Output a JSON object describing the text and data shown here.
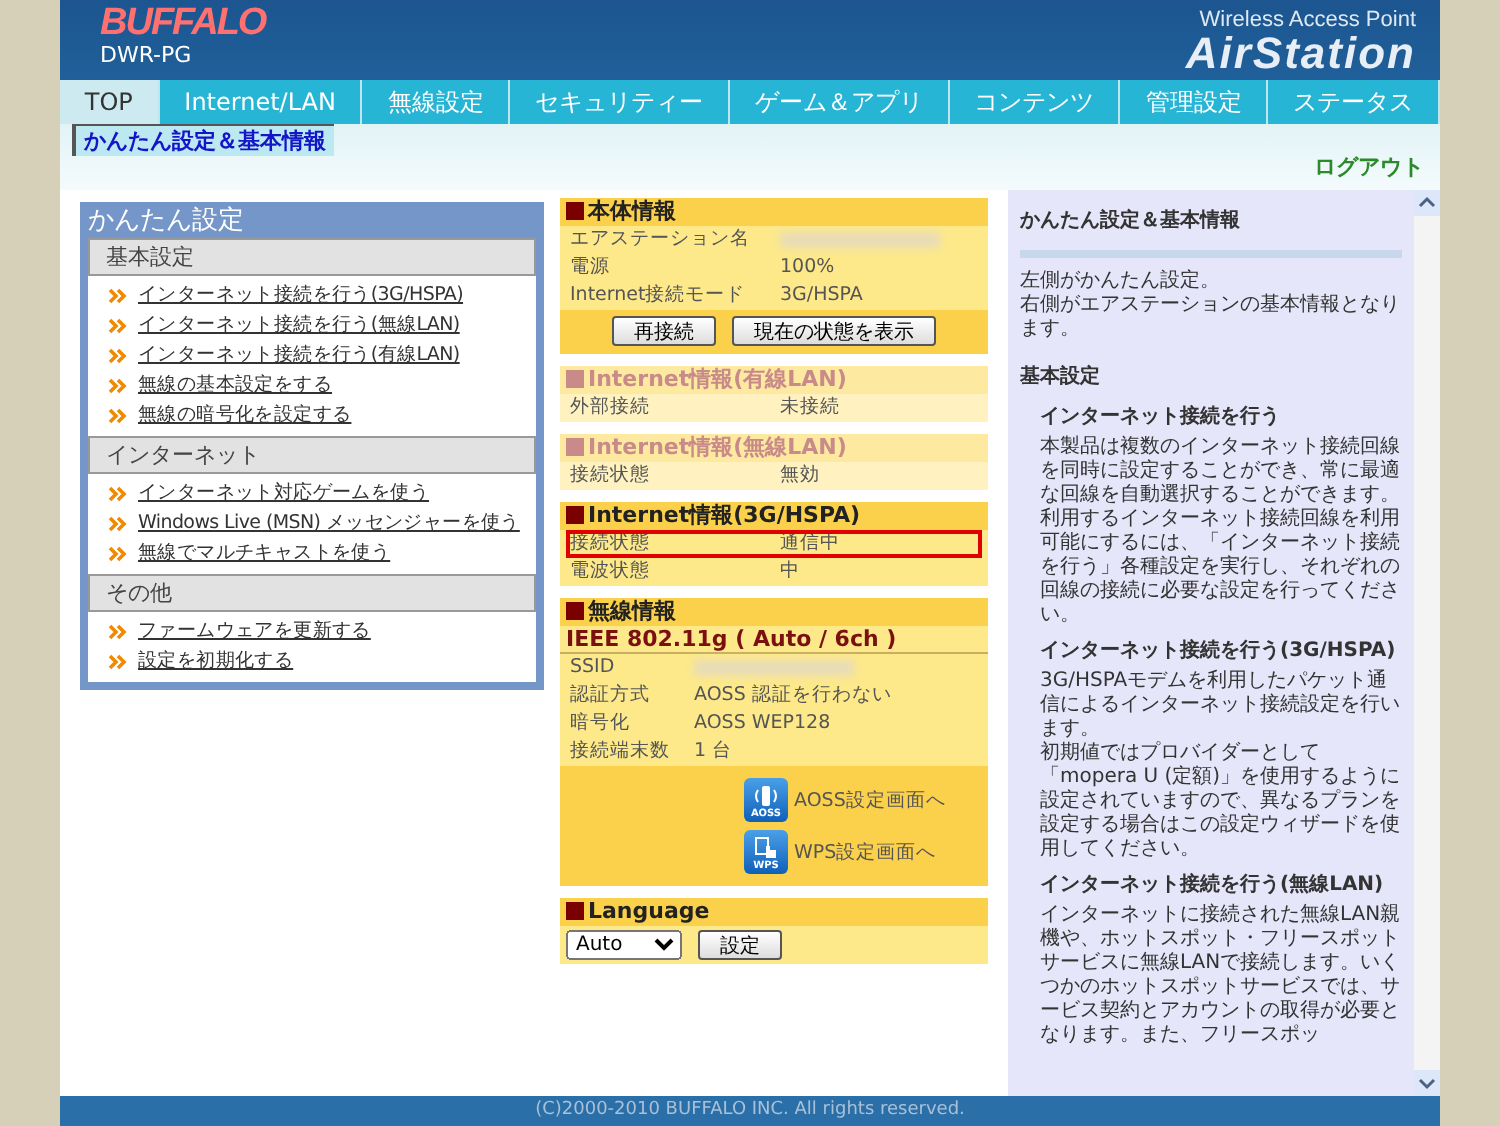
{
  "header": {
    "logo": "BUFFALO",
    "model": "DWR-PG",
    "product_line": "Wireless Access Point",
    "product_name": "AirStation"
  },
  "nav_tabs": [
    {
      "label": "TOP",
      "selected": true
    },
    {
      "label": "Internet/LAN",
      "selected": false
    },
    {
      "label": "無線設定",
      "selected": false
    },
    {
      "label": "セキュリティー",
      "selected": false
    },
    {
      "label": "ゲーム＆アプリ",
      "selected": false
    },
    {
      "label": "コンテンツ",
      "selected": false
    },
    {
      "label": "管理設定",
      "selected": false
    },
    {
      "label": "ステータス",
      "selected": false
    }
  ],
  "sub_tabs": [
    {
      "label": "かんたん設定＆基本情報",
      "selected": true
    }
  ],
  "logout": "ログアウト",
  "easy_setup": {
    "title": "かんたん設定",
    "sections": [
      {
        "heading": "基本設定",
        "links": [
          "インターネット接続を行う(3G/HSPA)",
          "インターネット接続を行う(無線LAN)",
          "インターネット接続を行う(有線LAN)",
          "無線の基本設定をする",
          "無線の暗号化を設定する"
        ]
      },
      {
        "heading": "インターネット",
        "links": [
          "インターネット対応ゲームを使う",
          "Windows Live (MSN) メッセンジャーを使う",
          "無線でマルチキャストを使う"
        ]
      },
      {
        "heading": "その他",
        "links": [
          "ファームウェアを更新する",
          "設定を初期化する"
        ]
      }
    ]
  },
  "info_panels": [
    {
      "title": "本体情報",
      "disabled": false,
      "rows": [
        {
          "label": "エアステーション名"
        },
        {
          "label": "電源",
          "value": "100%"
        },
        {
          "label": "Internet接続モード",
          "value": "3G/HSPA"
        }
      ],
      "buttons": [
        "再接続",
        "現在の状態を表示"
      ]
    },
    {
      "title": "Internet情報(有線LAN)",
      "disabled": true,
      "rows": [
        {
          "label": "外部接続",
          "value": "未接続"
        }
      ]
    },
    {
      "title": "Internet情報(無線LAN)",
      "disabled": true,
      "rows": [
        {
          "label": "接続状態",
          "value": "無効"
        }
      ]
    },
    {
      "title": "Internet情報(3G/HSPA)",
      "disabled": false,
      "rows": [
        {
          "label": "接続状態",
          "value": "通信中",
          "highlighted": true
        },
        {
          "label": "電波状態",
          "value": "中",
          "highlighted": false
        }
      ]
    }
  ],
  "wireless_info": {
    "title": "無線情報",
    "standard": "IEEE 802.11g ( Auto / 6ch )",
    "rows": [
      {
        "label": "SSID"
      },
      {
        "label": "認証方式",
        "value": "AOSS 認証を行わない"
      },
      {
        "label": "暗号化",
        "value": "AOSS WEP128"
      },
      {
        "label": "接続端末数",
        "value": "1 台"
      }
    ],
    "actions": [
      {
        "kind": "aoss",
        "badge": "AOSS",
        "label": "AOSS設定画面へ"
      },
      {
        "kind": "wps",
        "badge": "WPS",
        "label": "WPS設定画面へ"
      }
    ]
  },
  "language": {
    "title": "Language",
    "value": "Auto",
    "button": "設定"
  },
  "help": {
    "title": "かんたん設定＆基本情報",
    "intro": [
      "左側がかんたん設定。",
      "右側がエアステーションの基本情報となります。"
    ],
    "section": "基本設定",
    "topics": [
      {
        "heading": "インターネット接続を行う",
        "body": [
          "本製品は複数のインターネット接続回線を同時に設定することができ、常に最適な回線を自動選択することができます。",
          "利用するインターネット接続回線を利用可能にするには、「インターネット接続を行う」各種設定を実行し、それぞれの回線の接続に必要な設定を行ってください。"
        ]
      },
      {
        "heading": "インターネット接続を行う(3G/HSPA)",
        "body": [
          "3G/HSPAモデムを利用したパケット通信によるインターネット接続設定を行います。",
          "初期値ではプロバイダーとして「mopera U (定額)」を使用するように設定されていますので、異なるプランを設定する場合はこの設定ウィザードを使用してください。"
        ]
      },
      {
        "heading": "インターネット接続を行う(無線LAN)",
        "body": [
          "インターネットに接続された無線LAN親機や、ホットスポット・フリースポットサービスに無線LANで接続します。いくつかのホットスポットサービスでは、サービス契約とアカウントの取得が必要となります。また、フリースポッ"
        ]
      }
    ]
  },
  "footer": "(C)2000-2010 BUFFALO INC. All rights reserved."
}
